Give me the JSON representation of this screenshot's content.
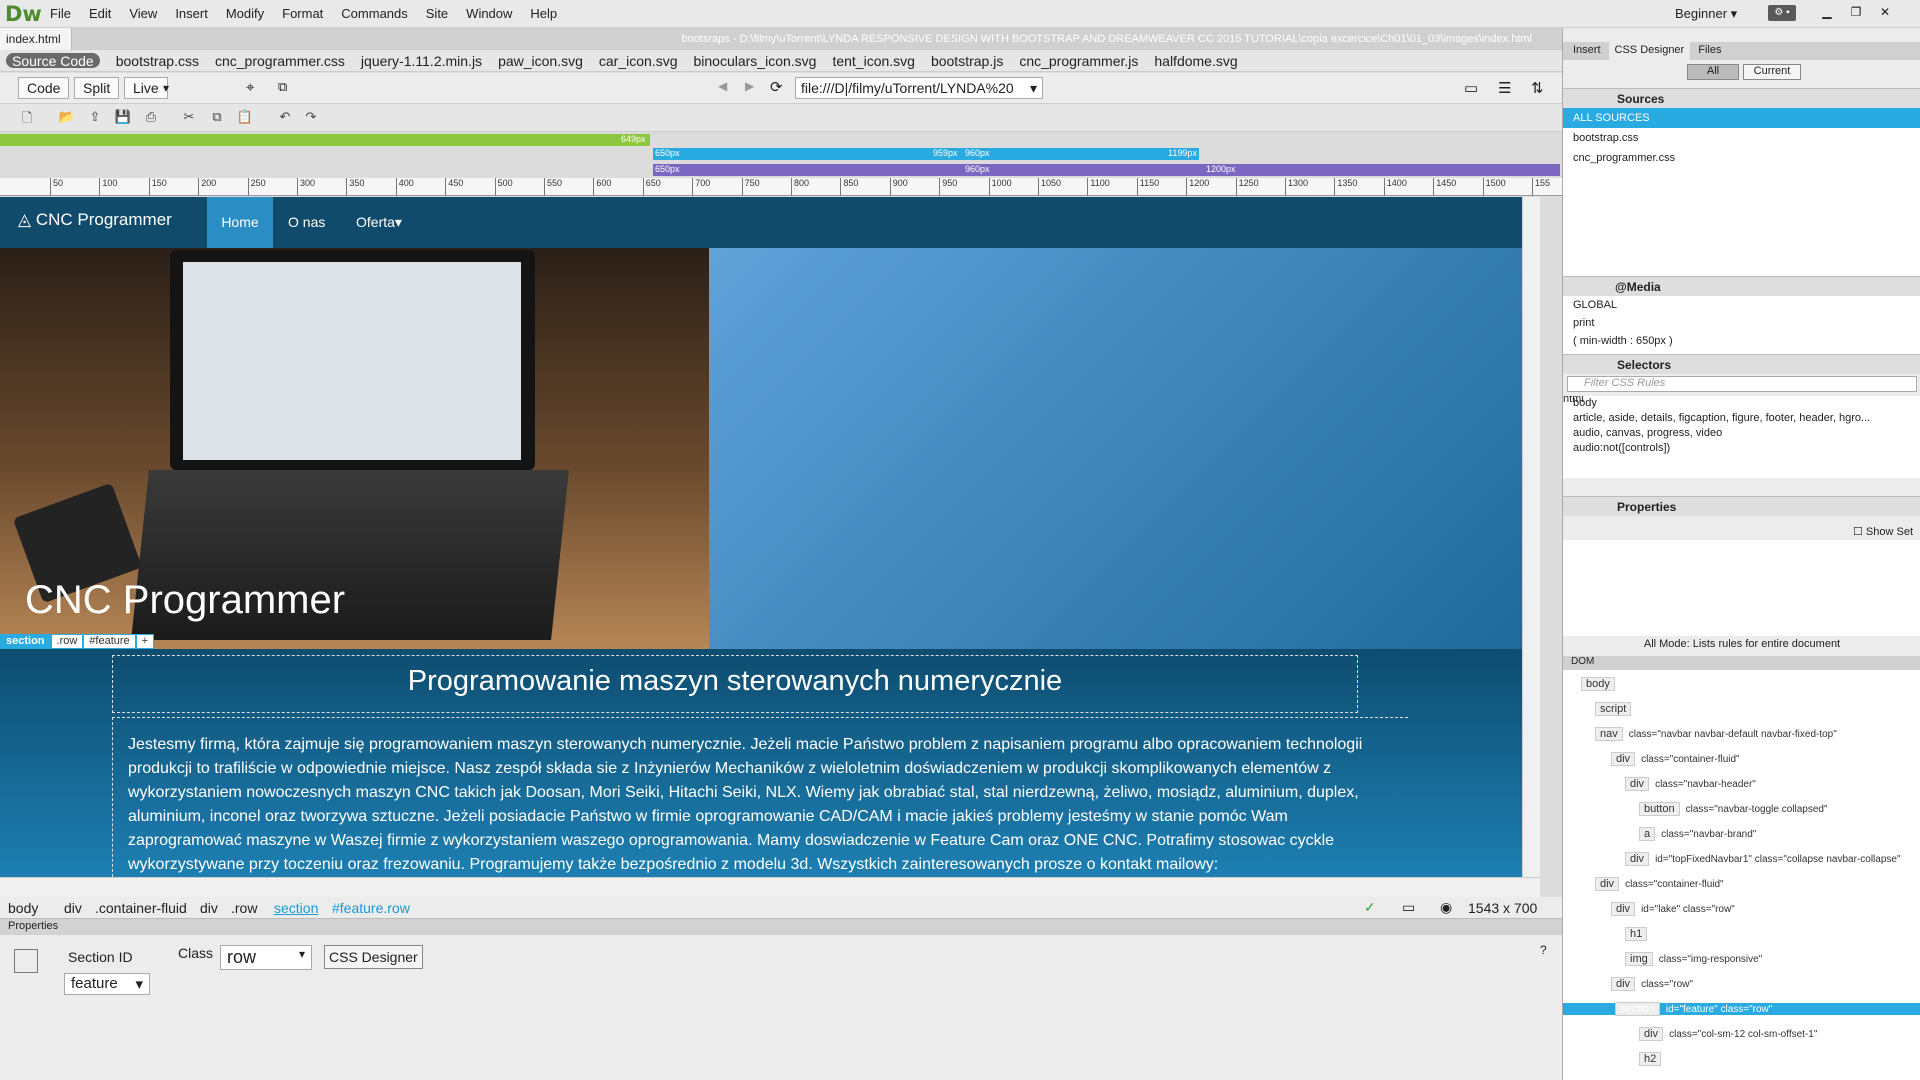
{
  "app": {
    "logo": "Dw",
    "menu": [
      "File",
      "Edit",
      "View",
      "Insert",
      "Modify",
      "Format",
      "Commands",
      "Site",
      "Window",
      "Help"
    ],
    "workspace": "Beginner",
    "gear": "⚙ ▪"
  },
  "document": {
    "tab": "index.html",
    "path": "bootsraps - D:\\filmy\\uTorrent\\LYNDA RESPONSIVE DESIGN WITH BOOTSTRAP AND DREAMWEAVER CC 2015 TUTORIAL\\copia excercice\\Ch01\\01_03\\images\\index.html",
    "related": [
      "Source Code",
      "bootstrap.css",
      "cnc_programmer.css",
      "jquery-1.11.2.min.js",
      "paw_icon.svg",
      "car_icon.svg",
      "binoculars_icon.svg",
      "tent_icon.svg",
      "bootstrap.js",
      "cnc_programmer.js",
      "halfdome.svg"
    ]
  },
  "toolbar": {
    "code": "Code",
    "split": "Split",
    "live": "Live",
    "url": "file:///D|/filmy/uTorrent/LYNDA%20"
  },
  "mediaqueries": {
    "green": "649px",
    "blue_a": "650px",
    "blue_b": "959px",
    "blue_c": "960px",
    "blue_d": "1199px",
    "purple_a": "650px",
    "purple_b": "960px",
    "purple_c": "1200px"
  },
  "ruler": [
    "50",
    "100",
    "150",
    "200",
    "250",
    "300",
    "350",
    "400",
    "450",
    "500",
    "550",
    "600",
    "650",
    "700",
    "750",
    "800",
    "850",
    "900",
    "950",
    "1000",
    "1050",
    "1100",
    "1150",
    "1200",
    "1250",
    "1300",
    "1350",
    "1400",
    "1450",
    "1500",
    "155"
  ],
  "page": {
    "brand": "CNC Programmer",
    "nav": [
      "Home",
      "O nas",
      "Oferta▾"
    ],
    "hero_title": "CNC Programmer",
    "selection": [
      "section",
      ".row",
      "#feature",
      "+"
    ],
    "feature_title": "Programowanie maszyn sterowanych numerycznie",
    "feature_text": "Jestesmy firmą, która zajmuje się programowaniem maszyn sterowanych numerycznie. Jeżeli macie Państwo problem z napisaniem programu albo opracowaniem technologii produkcji to trafiliście w odpowiednie miejsce. Nasz zespół składa sie z Inżynierów Mechaników z wieloletnim doświadczeniem w produkcji skomplikowanych elementów z wykorzystaniem nowoczesnych maszyn CNC takich jak Doosan, Mori Seiki, Hitachi Seiki, NLX. Wiemy jak obrabiać stal, stal nierdzewną, żeliwo, mosiądz, aluminium, duplex, aluminium, inconel oraz tworzywa sztuczne. Jeżeli posiadacie Państwo w firmie oprogramowanie CAD/CAM i macie jakieś problemy jesteśmy w stanie pomóc Wam zaprogramować maszyne w Waszej firmie z wykorzystaniem waszego oprogramowania. Mamy doswiadczenie w Feature Cam oraz ONE CNC. Potrafimy stosowac cyckle wykorzystywane przy toczeniu oraz frezowaniu. Programujemy także bezpośrednio z modelu 3d. Wszystkich zainteresowanych prosze o kontakt mailowy:"
  },
  "status": {
    "tags": [
      "body",
      "div",
      ".container-fluid",
      "div",
      ".row",
      "section",
      "#feature.row"
    ],
    "size": "1543 x 700"
  },
  "properties": {
    "title": "Properties",
    "section_id_label": "Section ID",
    "section_id": "feature",
    "class_label": "Class",
    "class_value": "row",
    "css_designer": "CSS Designer"
  },
  "right": {
    "tabs": [
      "Insert",
      "CSS Designer",
      "Files"
    ],
    "all": "All",
    "current": "Current",
    "sources_title": "Sources",
    "sources": [
      "ALL SOURCES",
      "bootstrap.css",
      "cnc_programmer.css"
    ],
    "media_title": "@Media",
    "media": [
      "GLOBAL",
      "print",
      "( min-width : 650px )"
    ],
    "selectors_title": "Selectors",
    "filter": "Filter CSS Rules",
    "selectors": [
      "html",
      "body",
      "article, aside, details, figcaption, figure, footer, header, hgro...",
      "audio, canvas, progress, video",
      "audio:not([controls])"
    ],
    "properties_title": "Properties",
    "show_set": "Show Set",
    "mode": "All Mode: Lists rules for entire document",
    "dom_tab": "DOM",
    "dom": [
      {
        "tag": "body",
        "attr": ""
      },
      {
        "tag": "script",
        "attr": ""
      },
      {
        "tag": "nav",
        "attr": "class=\"navbar navbar-default navbar-fixed-top\""
      },
      {
        "tag": "div",
        "attr": "class=\"container-fluid\""
      },
      {
        "tag": "div",
        "attr": "class=\"navbar-header\""
      },
      {
        "tag": "button",
        "attr": "class=\"navbar-toggle collapsed\""
      },
      {
        "tag": "a",
        "attr": "class=\"navbar-brand\""
      },
      {
        "tag": "div",
        "attr": "id=\"topFixedNavbar1\" class=\"collapse navbar-collapse\""
      },
      {
        "tag": "div",
        "attr": "class=\"container-fluid\""
      },
      {
        "tag": "div",
        "attr": "id=\"lake\" class=\"row\""
      },
      {
        "tag": "h1",
        "attr": ""
      },
      {
        "tag": "img",
        "attr": "class=\"img-responsive\""
      },
      {
        "tag": "div",
        "attr": "class=\"row\""
      },
      {
        "tag": "section",
        "attr": "id=\"feature\" class=\"row\""
      },
      {
        "tag": "div",
        "attr": "class=\"col-sm-12 col-sm-offset-1\""
      },
      {
        "tag": "h2",
        "attr": ""
      }
    ]
  }
}
